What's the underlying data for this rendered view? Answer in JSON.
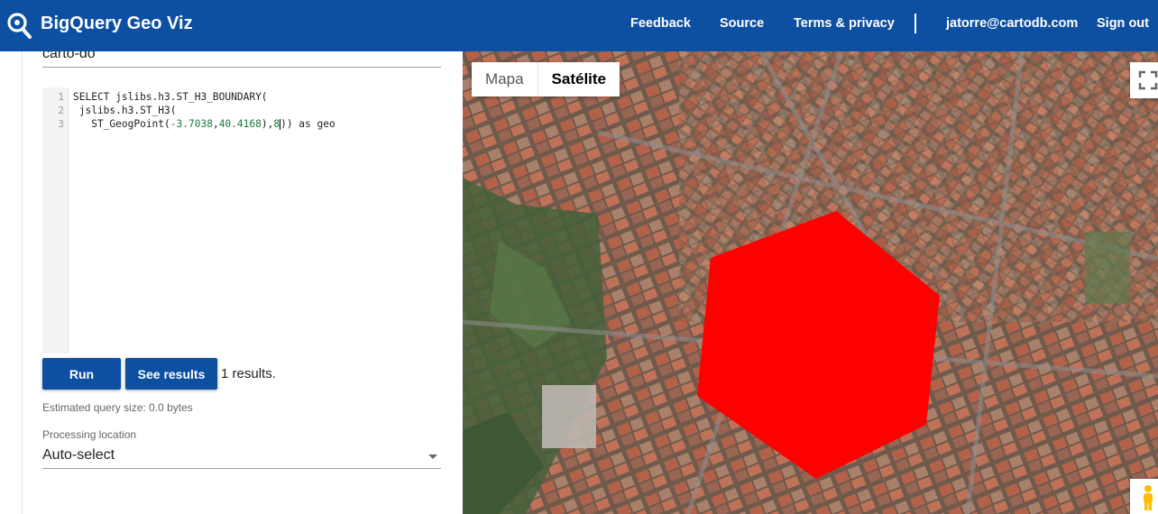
{
  "header": {
    "app_title": "BigQuery Geo Viz",
    "links": {
      "feedback": "Feedback",
      "source": "Source",
      "terms": "Terms & privacy",
      "user": "jatorre@cartodb.com",
      "signout": "Sign out"
    },
    "colors": {
      "bar": "#0d4fa1"
    }
  },
  "query_panel": {
    "project_id": "carto-do",
    "editor": {
      "line_numbers": [
        "1",
        "2",
        "3"
      ],
      "line1": "SELECT jslibs.h3.ST_H3_BOUNDARY(",
      "line2": " jslibs.h3.ST_H3(",
      "line3_a": "   ST_GeogPoint(",
      "line3_lng": "-3.7038",
      "line3_comma": ",",
      "line3_lat": "40.4168",
      "line3_b": "),",
      "line3_res": "8",
      "line3_c": ")) as geo"
    },
    "run_label": "Run",
    "see_results_label": "See results",
    "results_text": "1 results.",
    "estimated_size": "Estimated query size: 0.0 bytes",
    "processing_location_label": "Processing location",
    "processing_location_value": "Auto-select"
  },
  "map": {
    "type_map_label": "Mapa",
    "type_satellite_label": "Satélite",
    "selected_type": "Satélite",
    "feature_color": "#ff0000",
    "icons": [
      "fullscreen-icon",
      "pegman-icon"
    ]
  }
}
